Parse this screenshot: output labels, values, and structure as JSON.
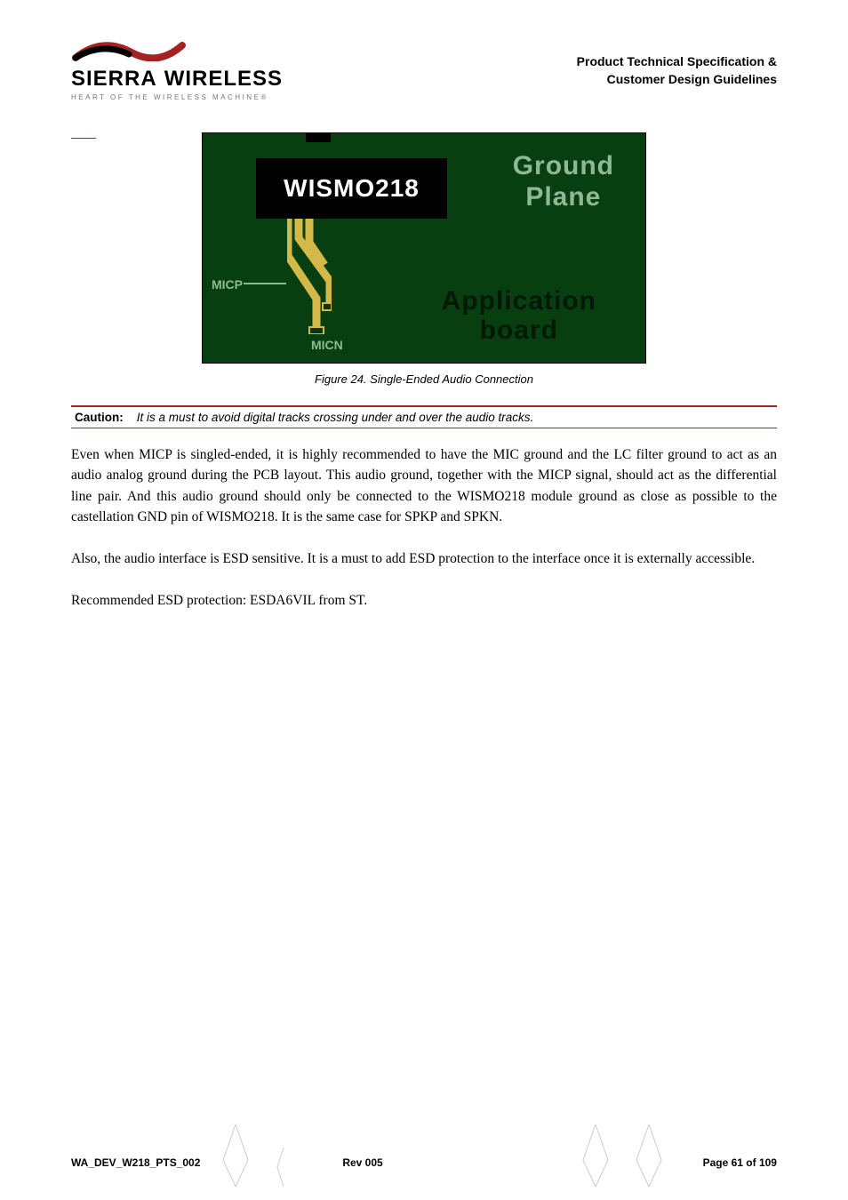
{
  "header": {
    "logo": {
      "brand1": "SIERRA",
      "brand2": "WIRELESS",
      "tagline": "HEART OF THE WIRELESS MACHINE®"
    },
    "title_line1": "Product Technical Specification &",
    "title_line2": "Customer Design Guidelines"
  },
  "figure": {
    "wismo": "WISMO218",
    "ground_line1": "Ground",
    "ground_line2": "Plane",
    "app_line1": "Application",
    "app_line2": "board",
    "micp": "MICP",
    "micn": "MICN",
    "caption": "Figure 24. Single-Ended Audio Connection"
  },
  "caution": {
    "label": "Caution:",
    "text": "It is a must to avoid digital tracks crossing under and over the audio tracks."
  },
  "paragraphs": {
    "p1": "Even when MICP is singled-ended, it is highly recommended to have the MIC ground and the LC filter ground to act as an audio analog ground during the PCB layout.  This audio ground, together with the MICP signal, should act as the differential line pair.  And this audio ground should only be connected to the WISMO218 module ground as close as possible to the castellation GND pin of WISMO218. It is the same case for SPKP and SPKN.",
    "p2": "Also, the audio interface is ESD sensitive. It is a must to add ESD protection to the interface once it is externally accessible.",
    "p3": "Recommended ESD protection: ESDA6VIL from ST."
  },
  "footer": {
    "left": "WA_DEV_W218_PTS_002",
    "center": "Rev 005",
    "right": "Page 61 of 109"
  }
}
